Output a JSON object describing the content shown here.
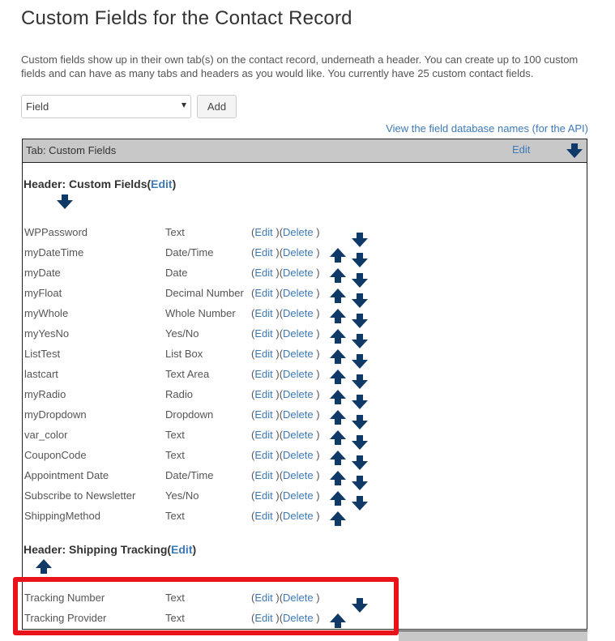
{
  "page": {
    "title": "Custom Fields for the Contact Record",
    "description": "Custom fields show up in their own tab(s) on the contact record, underneath a header. You can create up to 100 custom fields and can have as many tabs and headers as you would like. You currently have 25 custom contact fields."
  },
  "controls": {
    "select_value": "Field",
    "add_label": "Add",
    "api_link": "View the field database names (for the API)"
  },
  "tab": {
    "label": "Tab: Custom Fields",
    "edit_label": "Edit"
  },
  "common": {
    "edit_text": "Edit",
    "delete_text": "Delete"
  },
  "headers": [
    {
      "label": "Header: Custom Fields",
      "edit_label": "Edit",
      "fields": [
        {
          "name": "WPPassword",
          "type": "Text"
        },
        {
          "name": "myDateTime",
          "type": "Date/Time"
        },
        {
          "name": "myDate",
          "type": "Date"
        },
        {
          "name": "myFloat",
          "type": "Decimal Number"
        },
        {
          "name": "myWhole",
          "type": "Whole Number"
        },
        {
          "name": "myYesNo",
          "type": "Yes/No"
        },
        {
          "name": "ListTest",
          "type": "List Box"
        },
        {
          "name": "lastcart",
          "type": "Text Area"
        },
        {
          "name": "myRadio",
          "type": "Radio"
        },
        {
          "name": "myDropdown",
          "type": "Dropdown"
        },
        {
          "name": "var_color",
          "type": "Text"
        },
        {
          "name": "CouponCode",
          "type": "Text"
        },
        {
          "name": "Appointment Date",
          "type": "Date/Time"
        },
        {
          "name": "Subscribe to Newsletter",
          "type": "Yes/No"
        },
        {
          "name": "ShippingMethod",
          "type": "Text"
        }
      ]
    },
    {
      "label": "Header: Shipping Tracking",
      "edit_label": "Edit",
      "fields": [
        {
          "name": "Tracking Number",
          "type": "Text"
        },
        {
          "name": "Tracking Provider",
          "type": "Text"
        }
      ]
    }
  ],
  "colors": {
    "link": "#3d7ab8",
    "arrow": "#0f3a68",
    "highlight": "#e8131b",
    "tab_bar": "#c8c8c8"
  },
  "icons": {
    "up": "arrow-up-icon",
    "down": "arrow-down-icon"
  }
}
